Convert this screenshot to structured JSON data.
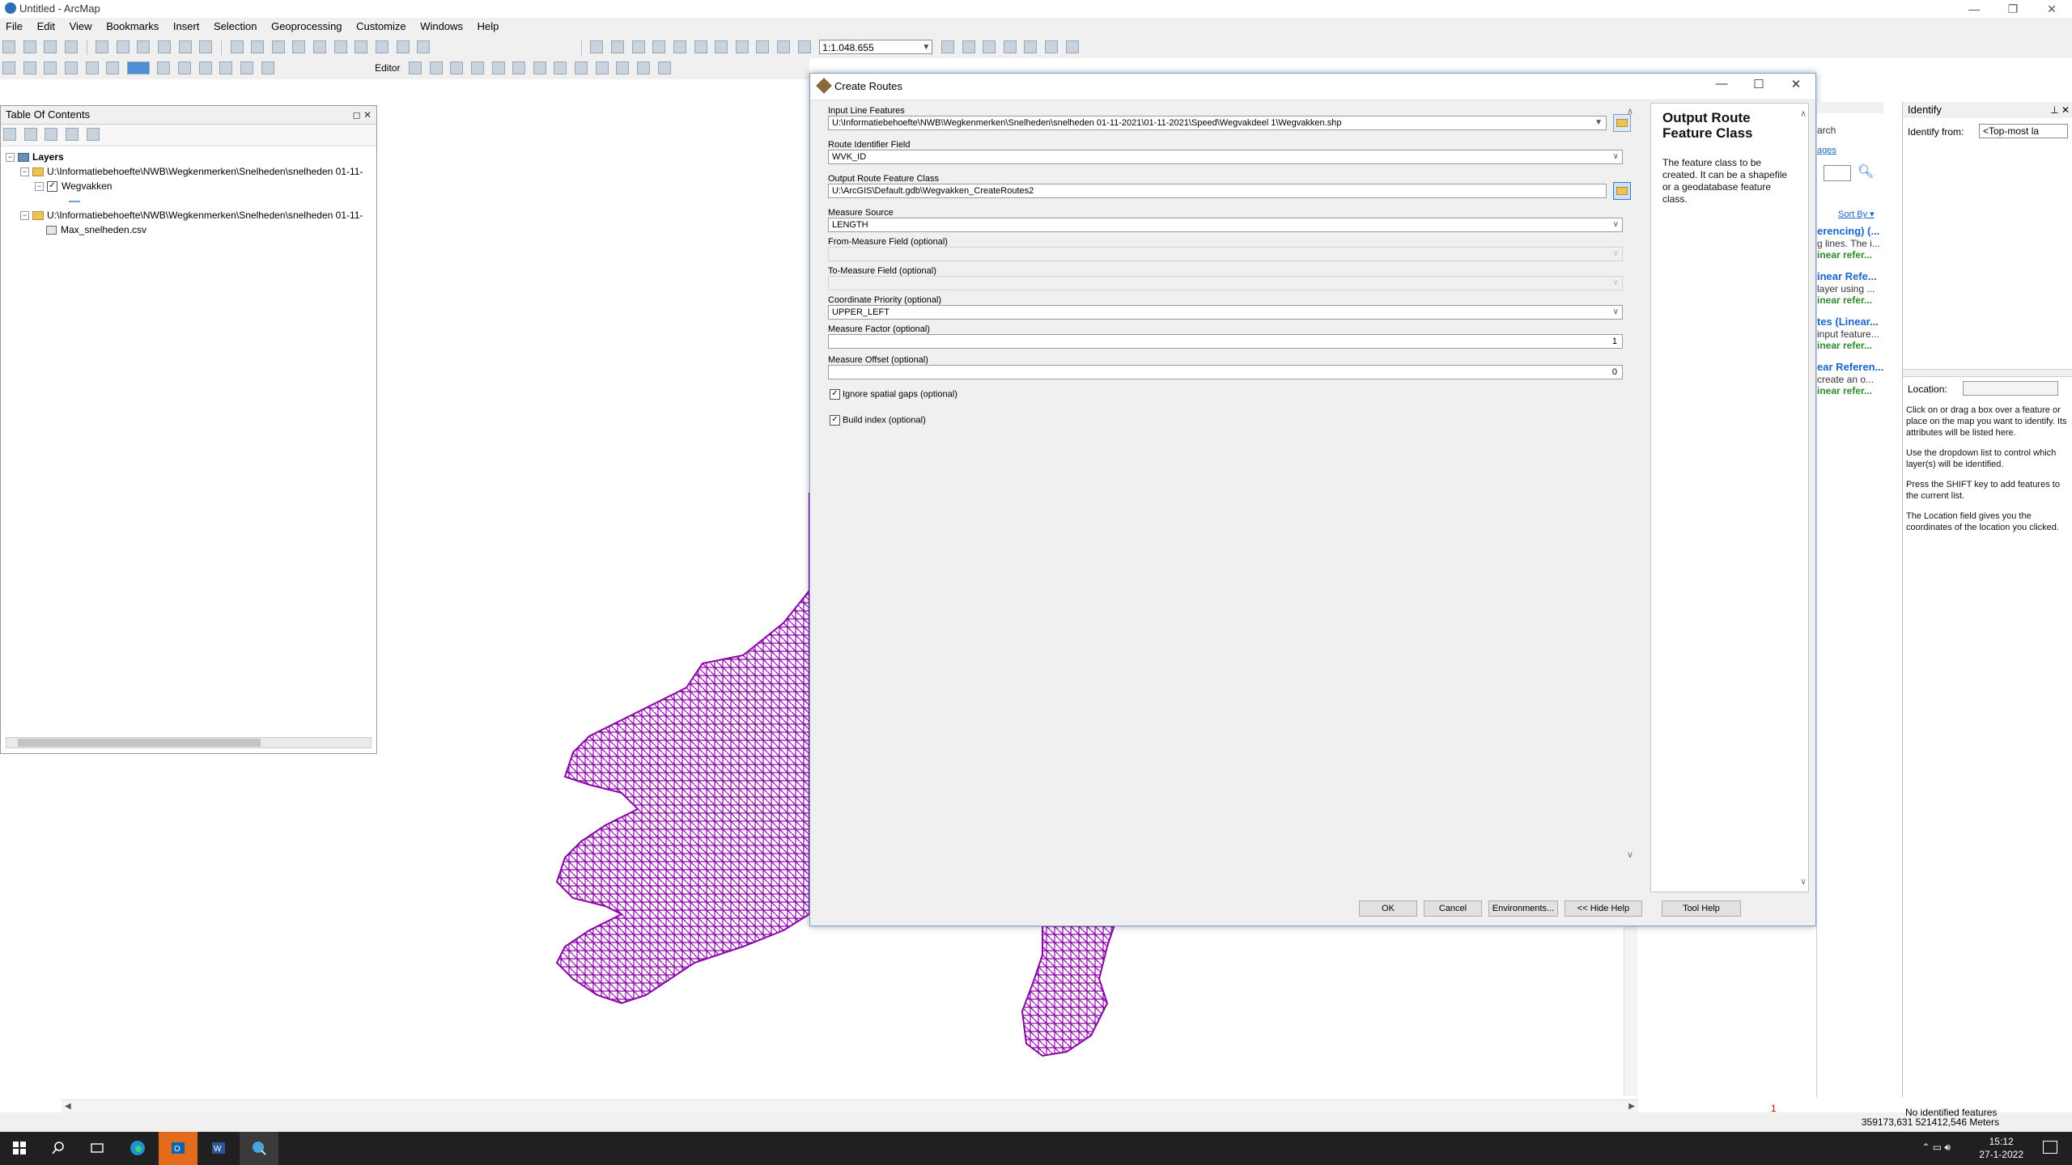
{
  "window": {
    "title": "Untitled - ArcMap",
    "controls": [
      "—",
      "❐",
      "✕"
    ]
  },
  "menu": [
    "File",
    "Edit",
    "View",
    "Bookmarks",
    "Insert",
    "Selection",
    "Geoprocessing",
    "Customize",
    "Windows",
    "Help"
  ],
  "toolbar": {
    "scale": "1:1.048.655",
    "editor_label": "Editor"
  },
  "toc": {
    "title": "Table Of Contents",
    "layers_label": "Layers",
    "items": [
      {
        "path": "U:\\Informatiebehoefte\\NWB\\Wegkenmerken\\Snelheden\\snelheden 01-11-"
      },
      {
        "layer": "Wegvakken"
      },
      {
        "path": "U:\\Informatiebehoefte\\NWB\\Wegkenmerken\\Snelheden\\snelheden 01-11-"
      },
      {
        "table": "Max_snelheden.csv"
      }
    ]
  },
  "dialog": {
    "title": "Create Routes",
    "fields": {
      "input_line_features": {
        "label": "Input Line Features",
        "value": "U:\\Informatiebehoefte\\NWB\\Wegkenmerken\\Snelheden\\snelheden 01-11-2021\\01-11-2021\\Speed\\Wegvakdeel 1\\Wegvakken.shp"
      },
      "route_identifier": {
        "label": "Route Identifier Field",
        "value": "WVK_ID"
      },
      "output_route": {
        "label": "Output Route Feature Class",
        "value": "U:\\ArcGIS\\Default.gdb\\Wegvakken_CreateRoutes2"
      },
      "measure_source": {
        "label": "Measure Source",
        "value": "LENGTH"
      },
      "from_measure": {
        "label": "From-Measure Field (optional)",
        "value": ""
      },
      "to_measure": {
        "label": "To-Measure Field (optional)",
        "value": ""
      },
      "coordinate_priority": {
        "label": "Coordinate Priority (optional)",
        "value": "UPPER_LEFT"
      },
      "measure_factor": {
        "label": "Measure Factor (optional)",
        "value": "1"
      },
      "measure_offset": {
        "label": "Measure Offset (optional)",
        "value": "0"
      },
      "ignore_gaps": {
        "label": "Ignore spatial gaps (optional)",
        "checked": true
      },
      "build_index": {
        "label": "Build index (optional)",
        "checked": true
      }
    },
    "help": {
      "title": "Output Route Feature Class",
      "text": "The feature class to be created. It can be a shapefile or a geodatabase feature class."
    },
    "buttons": {
      "ok": "OK",
      "cancel": "Cancel",
      "environments": "Environments...",
      "hide_help": "<< Hide Help",
      "tool_help": "Tool Help"
    }
  },
  "search": {
    "top": "arch",
    "link": "ages",
    "sort": "Sort By ▾",
    "results": [
      {
        "title": "erencing) (...",
        "desc": "g lines. The i...",
        "kind": "inear refer..."
      },
      {
        "title": "inear Refe...",
        "desc": "layer using ...",
        "kind": "inear refer..."
      },
      {
        "title": "tes (Linear...",
        "desc": "input feature...",
        "kind": "inear refer..."
      },
      {
        "title": "ear Referen...",
        "desc": "create an o...",
        "kind": "inear refer..."
      }
    ]
  },
  "identify": {
    "title": "Identify",
    "from_label": "Identify from:",
    "from_value": "<Top-most la",
    "location_label": "Location:",
    "instructions": [
      "Click on or drag a box over a feature or place on the map you want to identify. Its attributes will be listed here.",
      "Use the dropdown list to control which layer(s) will be identified.",
      "Press the SHIFT key to add features to the current list.",
      "The Location field gives you the coordinates of the location you clicked."
    ],
    "status": "No identified features"
  },
  "status": {
    "coords": "359173,631  521412,546 Meters",
    "page_indicator": "1"
  },
  "taskbar": {
    "time": "15:12",
    "date": "27-1-2022"
  },
  "colors": {
    "road_network": "#8b00a8",
    "accent": "#1a66c9",
    "taskbar": "#202020"
  }
}
